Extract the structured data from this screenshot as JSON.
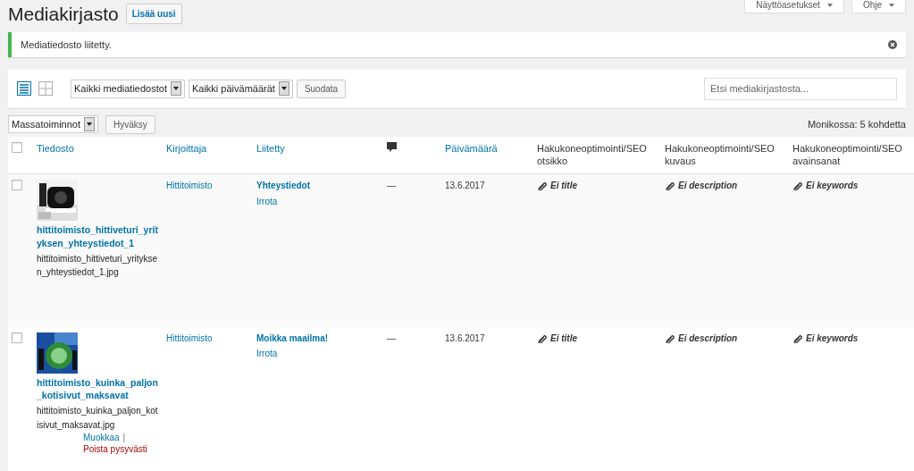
{
  "page": {
    "title": "Mediakirjasto",
    "add_new": "Lisää uusi"
  },
  "top_buttons": [
    {
      "label": "Näyttöasetukset"
    },
    {
      "label": "Ohje"
    }
  ],
  "notice": {
    "text": "Mediatiedosto liitetty.",
    "dismissible": true
  },
  "filter_bar": {
    "views": [
      {
        "kind": "list",
        "selected": true
      },
      {
        "kind": "grid",
        "selected": false
      }
    ],
    "type_filter": "Kaikki mediatiedostot",
    "date_filter": "Kaikki päivämäärät",
    "filter_button": "Suodata",
    "search": {
      "placeholder": "Etsi mediakirjastosta..."
    }
  },
  "bulk": {
    "action": "Massatoiminnot",
    "apply": "Hyväksy",
    "count": "Monikossa: 5 kohdetta"
  },
  "table": {
    "select_all_checked": false,
    "columns": [
      {
        "label": "Tiedosto",
        "kind": "link"
      },
      {
        "label": "Kirjoittaja",
        "kind": "link"
      },
      {
        "label": "Liitetty",
        "kind": "link"
      },
      {
        "kind": "comment-icon"
      },
      {
        "label": "Päivämäärä",
        "kind": "link"
      },
      {
        "label": "Hakukoneoptimointi/SEO otsikko",
        "kind": "text"
      },
      {
        "label": "Hakukoneoptimointi/SEO kuvaus",
        "kind": "text"
      },
      {
        "label": "Hakukoneoptimointi/SEO avainsanat",
        "kind": "text"
      }
    ],
    "rows": [
      {
        "checked": false,
        "title": "hittitoimisto_hittiveturi_yrityksen_yhteystiedot_1",
        "filename": "hittitoimisto_hittiveturi_yrityksen_yhteystiedot_1.jpg",
        "author": "Hittitoimisto",
        "attached_to": "Yhteystiedot",
        "detach": "Irrota",
        "comments": "—",
        "date": "13.6.2017",
        "seo_title": "Ei title",
        "seo_description": "Ei description",
        "seo_keywords": "Ei keywords"
      },
      {
        "checked": false,
        "title": "hittitoimisto_kuinka_paljon_kotisivut_maksavat",
        "filename": "hittitoimisto_kuinka_paljon_kotisivut_maksavat.jpg",
        "author": "Hittitoimisto",
        "attached_to": "Moikka maailma!",
        "detach": "Irrota",
        "comments": "—",
        "date": "13.6.2017",
        "seo_title": "Ei title",
        "seo_description": "Ei description",
        "seo_keywords": "Ei keywords",
        "actions": [
          {
            "label": "Muokkaa",
            "kind": "edit"
          },
          {
            "label": "Poista pysyvästi",
            "kind": "delete"
          }
        ],
        "action_separator": "|"
      }
    ]
  }
}
